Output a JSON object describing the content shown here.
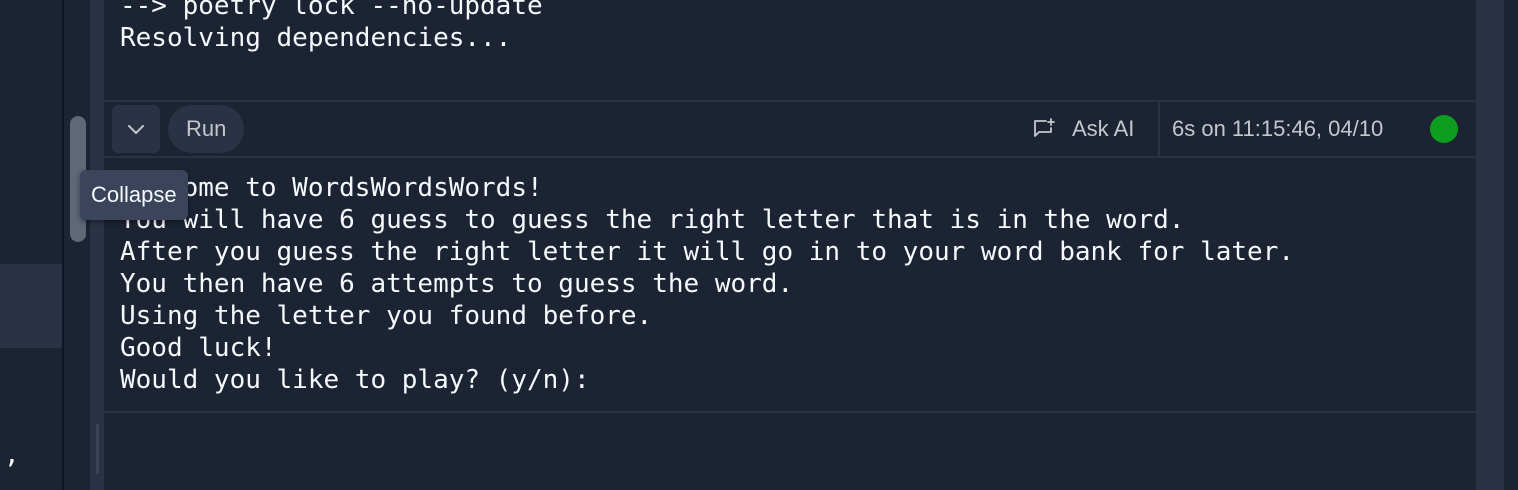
{
  "sidebar": {
    "stray_char": ","
  },
  "console": {
    "previous_output": [
      "--> poetry lock --no-update",
      "Resolving dependencies..."
    ],
    "toolbar": {
      "collapse_icon": "chevron-down-icon",
      "run_label": "Run",
      "ask_ai_icon": "chat-sparkle-icon",
      "ask_ai_label": "Ask AI",
      "status_text": "6s on 11:15:46, 04/10",
      "status_color": "#0f9d1f"
    },
    "output_lines": [
      "Welcome to WordsWordsWords!",
      "You will have 6 guess to guess the right letter that is in the word.",
      "After you guess the right letter it will go in to your word bank for later.",
      "You then have 6 attempts to guess the word.",
      "Using the letter you found before.",
      "Good luck!",
      "Would you like to play? (y/n): "
    ]
  },
  "tooltip": {
    "text": "Collapse"
  },
  "colors": {
    "background": "#1c2333",
    "surface": "#2b3245",
    "text": "#f5f9fc",
    "muted_text": "#c2c8cc"
  }
}
